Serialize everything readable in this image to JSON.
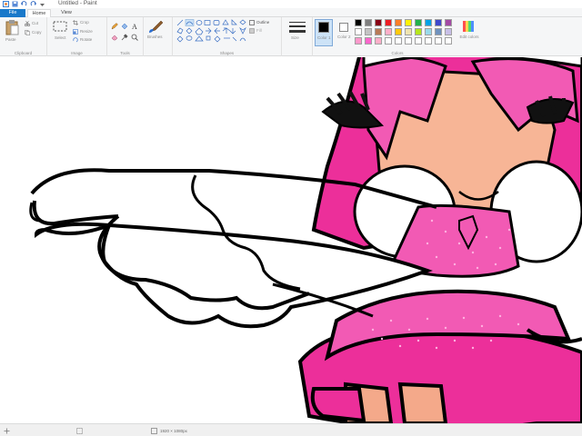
{
  "window": {
    "title": "Untitled - Paint"
  },
  "tabs": [
    {
      "label": "File"
    },
    {
      "label": "Home"
    },
    {
      "label": "View"
    }
  ],
  "ribbon": {
    "clipboard": {
      "paste": "Paste",
      "cut": "Cut",
      "copy": "Copy",
      "group": "Clipboard"
    },
    "image": {
      "select": "Select",
      "crop": "Crop",
      "resize": "Resize",
      "rotate": "Rotate",
      "group": "Image"
    },
    "tools": {
      "group": "Tools"
    },
    "brushes": {
      "label": "Brushes"
    },
    "shapes": {
      "outline": "Outline",
      "fill": "Fill",
      "group": "Shapes"
    },
    "size": {
      "label": "Size"
    },
    "colors": {
      "color1": "Color 1",
      "color2": "Color 2",
      "edit": "Edit colors",
      "group": "Colors",
      "color1_value": "#000000",
      "color2_value": "#ffffff",
      "palette": [
        "#000000",
        "#7f7f7f",
        "#880015",
        "#ed1c24",
        "#ff7f27",
        "#fff200",
        "#22b14c",
        "#00a2e8",
        "#3f48cc",
        "#a349a4",
        "#ffffff",
        "#c3c3c3",
        "#b97a57",
        "#ffaec9",
        "#ffc90e",
        "#efe4b0",
        "#b5e61d",
        "#99d9ea",
        "#7092be",
        "#c8bfe7",
        "#ff99cc",
        "#ff66cc",
        "#ffaec9",
        "#ffffff",
        "#ffffff",
        "#ffffff",
        "#ffffff",
        "#ffffff",
        "#ffffff",
        "#ffffff"
      ]
    }
  },
  "statusbar": {
    "position": "",
    "selection": "",
    "size": "1920 × 1080px"
  }
}
